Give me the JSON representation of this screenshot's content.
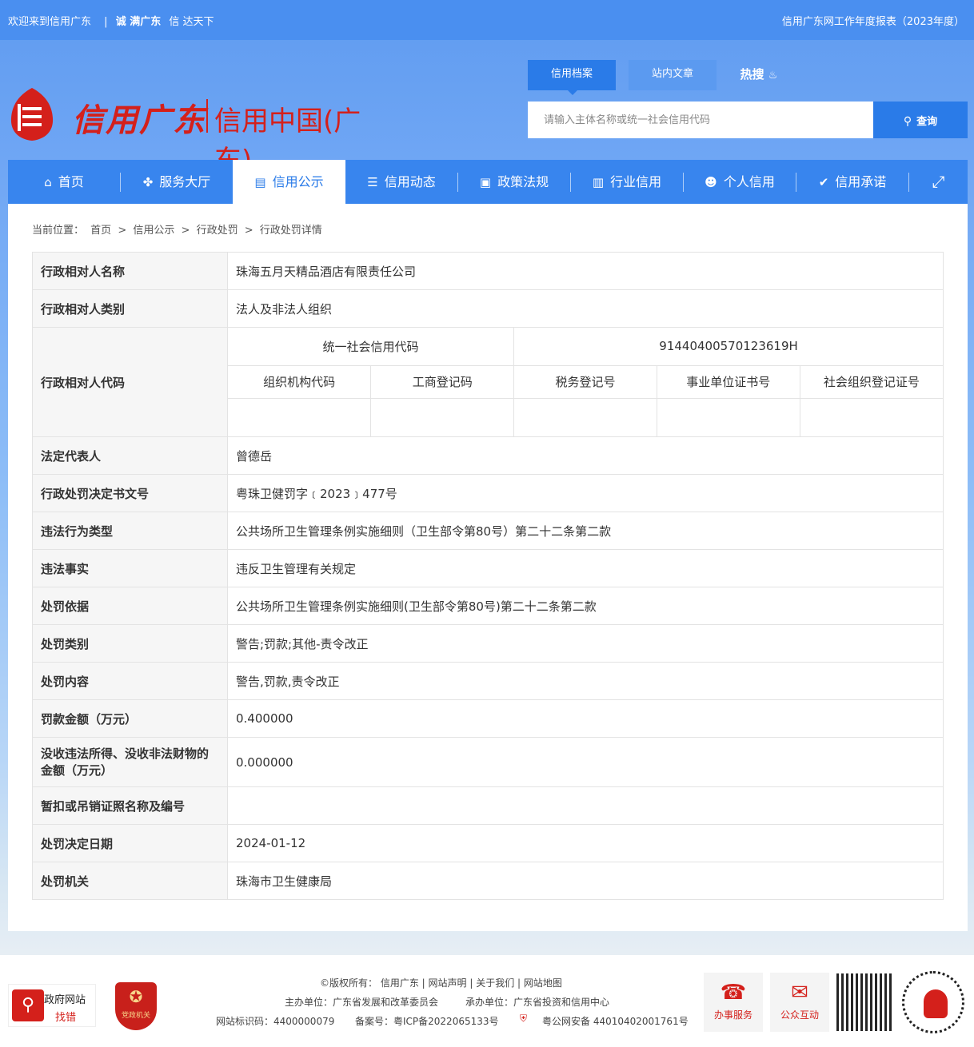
{
  "topbar": {
    "welcome": "欢迎来到信用广东",
    "divider": "|",
    "slogan1": "诚 满广东",
    "slogan2": "信 达天下",
    "report": "信用广东网工作年度报表（2023年度）"
  },
  "logo": {
    "brand": "信用广东",
    "sub": "信用中国(广东)"
  },
  "header_tabs": [
    "信用档案",
    "站内文章",
    "热搜"
  ],
  "search": {
    "placeholder": "请输入主体名称或统一社会信用代码",
    "button": "查询"
  },
  "nav": [
    {
      "label": "首页",
      "icon": "home-icon",
      "glyph": "⌂"
    },
    {
      "label": "服务大厅",
      "icon": "grid-icon",
      "glyph": "✤"
    },
    {
      "label": "信用公示",
      "icon": "board-icon",
      "glyph": "▤"
    },
    {
      "label": "信用动态",
      "icon": "doc-icon",
      "glyph": "☰"
    },
    {
      "label": "政策法规",
      "icon": "book-icon",
      "glyph": "▣"
    },
    {
      "label": "行业信用",
      "icon": "building-icon",
      "glyph": "▥"
    },
    {
      "label": "个人信用",
      "icon": "idcard-icon",
      "glyph": "☻"
    },
    {
      "label": "信用承诺",
      "icon": "shield-icon",
      "glyph": "✔"
    },
    {
      "label": "",
      "icon": "expand-icon",
      "glyph": "⤢"
    }
  ],
  "breadcrumb": {
    "prefix": "当前位置：",
    "items": [
      "首页",
      "信用公示",
      "行政处罚",
      "行政处罚详情"
    ],
    "separator": ">"
  },
  "detail": {
    "name_label": "行政相对人名称",
    "name_value": "珠海五月天精品酒店有限责任公司",
    "type_label": "行政相对人类别",
    "type_value": "法人及非法人组织",
    "code_label": "行政相对人代码",
    "uscc_label": "统一社会信用代码",
    "uscc_value": "91440400570123619H",
    "code_headers": [
      "组织机构代码",
      "工商登记码",
      "税务登记号",
      "事业单位证书号",
      "社会组织登记证号"
    ],
    "code_values": [
      "",
      "",
      "",
      "",
      ""
    ],
    "rep_label": "法定代表人",
    "rep_value": "曾德岳",
    "doc_label": "行政处罚决定书文号",
    "doc_value": "粤珠卫健罚字﹝2023﹞477号",
    "violation_type_label": "违法行为类型",
    "violation_type_value": "公共场所卫生管理条例实施细则（卫生部令第80号）第二十二条第二款",
    "fact_label": "违法事实",
    "fact_value": "违反卫生管理有关规定",
    "basis_label": "处罚依据",
    "basis_value": "公共场所卫生管理条例实施细则(卫生部令第80号)第二十二条第二款",
    "category_label": "处罚类别",
    "category_value": "警告;罚款;其他-责令改正",
    "content_label": "处罚内容",
    "content_value": "警告,罚款,责令改正",
    "fine_label": "罚款金额（万元）",
    "fine_value": "0.400000",
    "confiscate_label": "没收违法所得、没收非法财物的金额（万元）",
    "confiscate_value": "0.000000",
    "license_label": "暂扣或吊销证照名称及编号",
    "license_value": "",
    "date_label": "处罚决定日期",
    "date_value": "2024-01-12",
    "authority_label": "处罚机关",
    "authority_value": "珠海市卫生健康局"
  },
  "footer": {
    "badge_top": "政府网站",
    "badge_bottom": "找错",
    "party_badge": "党政机关",
    "links_prefix": "©版权所有：",
    "links": [
      "信用广东",
      "网站声明",
      "关于我们",
      "网站地图"
    ],
    "host": "主办单位：广东省发展和改革委员会",
    "undertaker": "承办单位：广东省投资和信用中心",
    "site_id": "网站标识码：4400000079",
    "icp": "备案号：粤ICP备2022065133号",
    "police": "粤公网安备 44010402001761号",
    "service": "办事服务",
    "interact": "公众互动"
  }
}
